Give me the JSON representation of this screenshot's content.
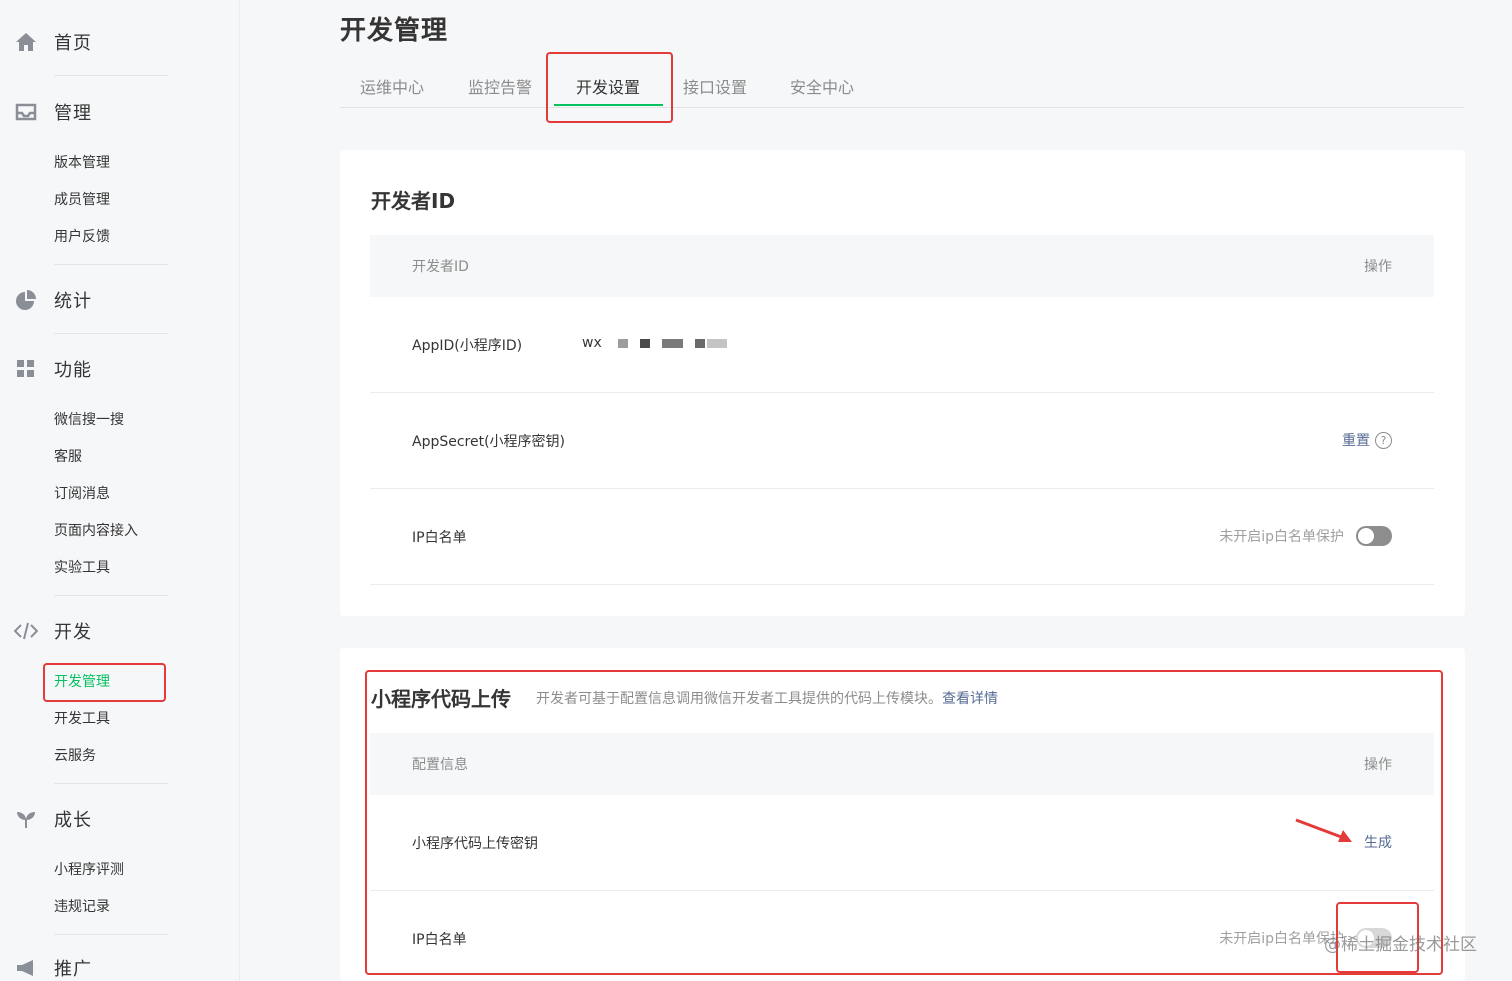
{
  "sidebar": {
    "groups": [
      {
        "icon": "home-icon",
        "label": "首页",
        "items": []
      },
      {
        "icon": "inbox-icon",
        "label": "管理",
        "items": [
          "版本管理",
          "成员管理",
          "用户反馈"
        ]
      },
      {
        "icon": "pie-chart-icon",
        "label": "统计",
        "items": []
      },
      {
        "icon": "grid-icon",
        "label": "功能",
        "items": [
          "微信搜一搜",
          "客服",
          "订阅消息",
          "页面内容接入",
          "实验工具"
        ]
      },
      {
        "icon": "code-icon",
        "label": "开发",
        "items": [
          "开发管理",
          "开发工具",
          "云服务"
        ]
      },
      {
        "icon": "sprout-icon",
        "label": "成长",
        "items": [
          "小程序评测",
          "违规记录"
        ]
      },
      {
        "icon": "megaphone-icon",
        "label": "推广",
        "items": []
      }
    ],
    "active_item": "开发管理"
  },
  "page": {
    "title": "开发管理",
    "tabs": [
      "运维中心",
      "监控告警",
      "开发设置",
      "接口设置",
      "安全中心"
    ],
    "active_tab": "开发设置"
  },
  "developer_id_card": {
    "title": "开发者ID",
    "columns": [
      "开发者ID",
      "操作"
    ],
    "rows": [
      {
        "key": "AppID(小程序ID)",
        "value": "wx",
        "action": ""
      },
      {
        "key": "AppSecret(小程序密钥)",
        "value": "",
        "action": "重置"
      },
      {
        "key": "IP白名单",
        "value": "",
        "hint": "未开启ip白名单保护",
        "toggle": false
      }
    ]
  },
  "upload_card": {
    "title": "小程序代码上传",
    "description": "开发者可基于配置信息调用微信开发者工具提供的代码上传模块。",
    "link": "查看详情",
    "columns": [
      "配置信息",
      "操作"
    ],
    "rows": [
      {
        "key": "小程序代码上传密钥",
        "action": "生成"
      },
      {
        "key": "IP白名单",
        "hint": "未开启ip白名单保护",
        "toggle": false
      }
    ]
  },
  "watermark": "@稀土掘金技术社区",
  "colors": {
    "accent": "#07c160",
    "link": "#576b95",
    "annotation": "#e33a3a"
  }
}
